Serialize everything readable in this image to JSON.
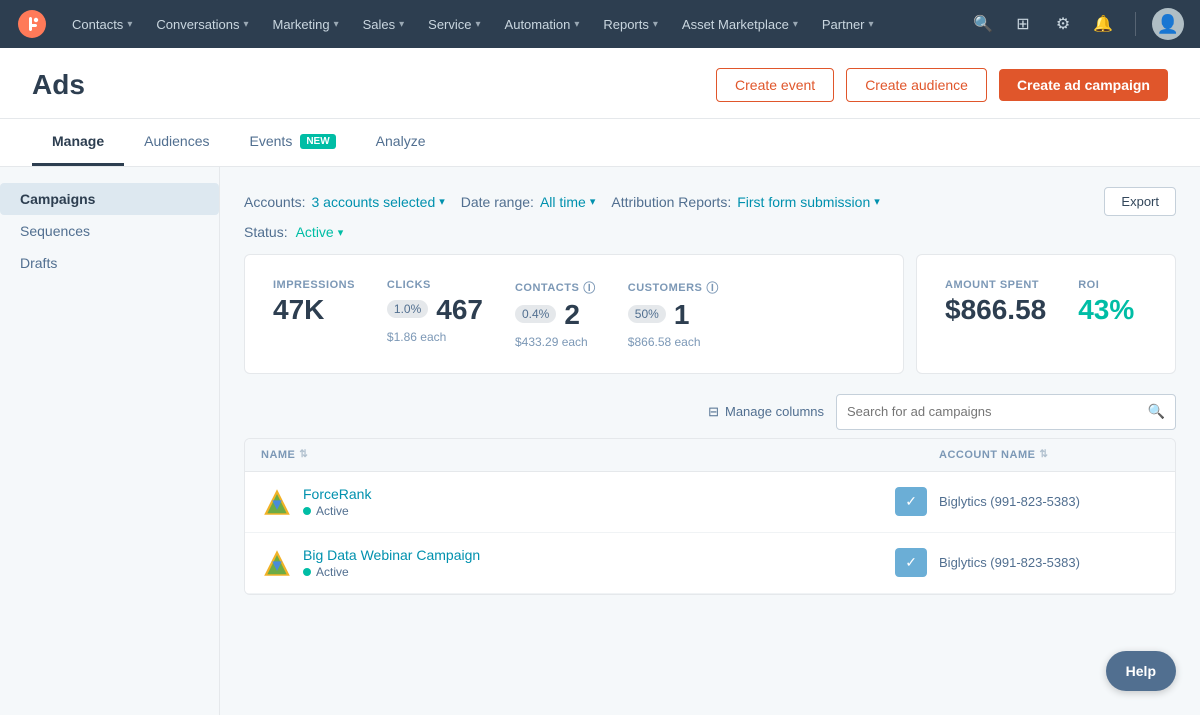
{
  "nav": {
    "items": [
      {
        "label": "Contacts",
        "has_chevron": true
      },
      {
        "label": "Conversations",
        "has_chevron": true
      },
      {
        "label": "Marketing",
        "has_chevron": true
      },
      {
        "label": "Sales",
        "has_chevron": true
      },
      {
        "label": "Service",
        "has_chevron": true
      },
      {
        "label": "Automation",
        "has_chevron": true
      },
      {
        "label": "Reports",
        "has_chevron": true
      },
      {
        "label": "Asset Marketplace",
        "has_chevron": true
      },
      {
        "label": "Partner",
        "has_chevron": true
      }
    ]
  },
  "header": {
    "title": "Ads",
    "create_event_label": "Create event",
    "create_audience_label": "Create audience",
    "create_campaign_label": "Create ad campaign"
  },
  "tabs": [
    {
      "label": "Manage",
      "active": true,
      "badge": null
    },
    {
      "label": "Audiences",
      "active": false,
      "badge": null
    },
    {
      "label": "Events",
      "active": false,
      "badge": "NEW"
    },
    {
      "label": "Analyze",
      "active": false,
      "badge": null
    }
  ],
  "sidebar": {
    "items": [
      {
        "label": "Campaigns",
        "active": true
      },
      {
        "label": "Sequences",
        "active": false
      },
      {
        "label": "Drafts",
        "active": false
      }
    ]
  },
  "filters": {
    "accounts_label": "Accounts:",
    "accounts_value": "3 accounts selected",
    "date_range_label": "Date range:",
    "date_range_value": "All time",
    "attribution_label": "Attribution Reports:",
    "attribution_value": "First form submission",
    "status_label": "Status:",
    "status_value": "Active",
    "export_label": "Export"
  },
  "stats": {
    "impressions": {
      "label": "IMPRESSIONS",
      "value": "47K"
    },
    "clicks": {
      "label": "CLICKS",
      "badge": "1.0%",
      "value": "467",
      "sub": "$1.86 each"
    },
    "contacts": {
      "label": "CONTACTS",
      "badge": "0.4%",
      "value": "2",
      "sub": "$433.29 each"
    },
    "customers": {
      "label": "CUSTOMERS",
      "badge": "50%",
      "value": "1",
      "sub": "$866.58 each"
    },
    "amount_spent": {
      "label": "AMOUNT SPENT",
      "value": "$866.58"
    },
    "roi": {
      "label": "ROI",
      "value": "43%"
    }
  },
  "table": {
    "manage_columns_label": "Manage columns",
    "search_placeholder": "Search for ad campaigns",
    "columns": [
      {
        "label": "NAME",
        "sortable": true
      },
      {
        "label": "ACCOUNT NAME",
        "sortable": true
      }
    ],
    "rows": [
      {
        "name": "ForceRank",
        "status": "Active",
        "account": "Biglytics (991-823-5383)",
        "enabled": true
      },
      {
        "name": "Big Data Webinar Campaign",
        "status": "Active",
        "account": "Biglytics (991-823-5383)",
        "enabled": true
      }
    ]
  },
  "help": {
    "label": "Help"
  },
  "colors": {
    "accent_orange": "#e0562b",
    "teal": "#00bda5",
    "link_blue": "#0091ae",
    "nav_bg": "#2d3e50",
    "toggle_blue": "#6baed6"
  }
}
